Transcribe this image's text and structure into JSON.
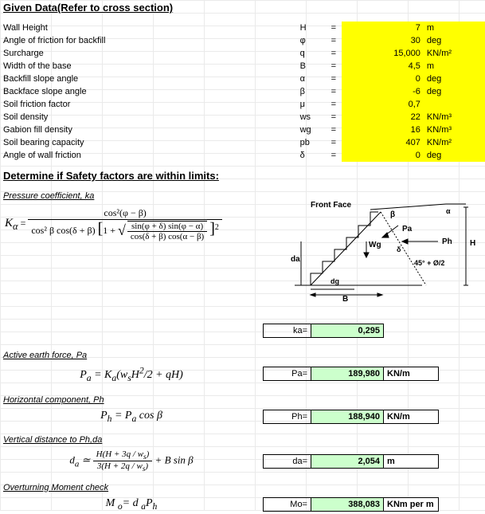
{
  "titles": {
    "given_data": "Given Data(Refer to cross section)",
    "determine": "Determine if Safety factors are within limits:"
  },
  "params": [
    {
      "label": "Wall Height",
      "sym": "H",
      "val": "7",
      "unit": "m"
    },
    {
      "label": "Angle of friction for backfill",
      "sym": "φ",
      "val": "30",
      "unit": "deg"
    },
    {
      "label": "Surcharge",
      "sym": "q",
      "val": "15,000",
      "unit": "KN/m²"
    },
    {
      "label": "Width of the base",
      "sym": "B",
      "val": "4,5",
      "unit": "m"
    },
    {
      "label": "Backfill slope angle",
      "sym": "α",
      "val": "0",
      "unit": "deg"
    },
    {
      "label": "Backface slope angle",
      "sym": "β",
      "val": "-6",
      "unit": "deg"
    },
    {
      "label": "Soil friction factor",
      "sym": "μ",
      "val": "0,7",
      "unit": ""
    },
    {
      "label": "Soil density",
      "sym": "ws",
      "val": "22",
      "unit": "KN/m³"
    },
    {
      "label": "Gabion fill density",
      "sym": "wg",
      "val": "16",
      "unit": "KN/m³"
    },
    {
      "label": "Soil bearing capacity",
      "sym": "pb",
      "val": "407",
      "unit": "KN/m²"
    },
    {
      "label": "Angle of wall friction",
      "sym": "δ",
      "val": "0",
      "unit": "deg"
    }
  ],
  "sections": {
    "pressure_coeff": "Pressure coefficient, ka",
    "active_force": "Active earth force, Pa",
    "horiz_comp": "Horizontal component, Ph",
    "vert_dist": "Vertical distance to Ph,da",
    "overturning": "Overturning Moment check"
  },
  "formulas": {
    "ka": "Ka = cos²(φ−β) / [ cos²β cos(δ+β) (1 + √( sin(φ+δ) sin(φ−α) / (cos(δ+β) cos(α−β)) ))² ]",
    "pa": "Pₐ = Kₐ(wₛH²/2 + qH)",
    "ph": "Pₕ = Pₐ cos β",
    "da": "dₐ ≃ H(H+3q/wₛ) / 3(H+2q/wₛ) + B sin β",
    "mo": "M ₒ = d ₐPₕ"
  },
  "results": {
    "ka": {
      "label": "ka=",
      "val": "0,295",
      "unit": ""
    },
    "pa": {
      "label": "Pa=",
      "val": "189,980",
      "unit": "KN/m"
    },
    "ph": {
      "label": "Ph=",
      "val": "188,940",
      "unit": "KN/m"
    },
    "da": {
      "label": "da=",
      "val": "2,054",
      "unit": "m"
    },
    "mo": {
      "label": "Mo=",
      "val": "388,083",
      "unit": "KNm per m"
    }
  },
  "diagram_labels": {
    "front_face": "Front Face",
    "beta": "β",
    "pa": "Pa",
    "ph": "Ph",
    "wg": "Wg",
    "H": "H",
    "da": "da",
    "dg": "dg",
    "B": "B",
    "delta": "δ",
    "angle": "45° + Ø/2",
    "alpha": "α"
  }
}
